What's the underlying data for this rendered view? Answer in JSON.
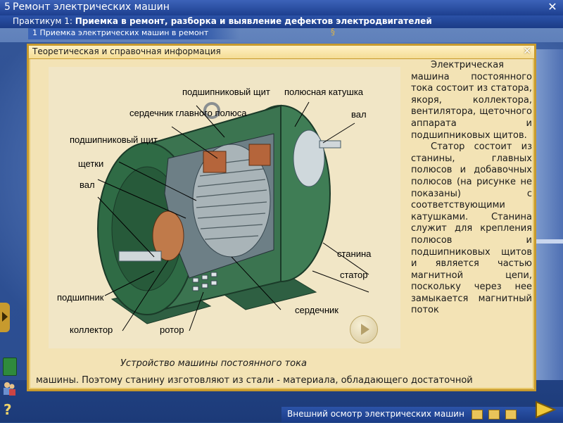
{
  "window": {
    "number": "5",
    "title": "Ремонт электрических машин"
  },
  "subtitle": {
    "prefix": "Практикум 1:",
    "text": "Приемка в ремонт, разборка и выявление дефектов электродвигателей"
  },
  "topic": "1 Приемка электрических машин в ремонт",
  "panel": {
    "title": "Теоретическая и справочная информация",
    "caption": "Устройство машины постоянного тока",
    "paragraph1": "Электрическая машина постоянного тока состоит из статора, якоря, коллектора, вентилятора, щеточного аппарата и подшипниковых щитов.",
    "paragraph2": "Статор состоит из станины, главных полюсов и добавочных полюсов (на рисунке не показаны) с соответствующими катушками. Станина служит для крепления полюсов и подшипниковых щитов и является частью магнитной цепи, поскольку через нее замыкается магнитный поток",
    "bottom_text": "машины. Поэтому станину изготовляют из стали - материала, обладающего достаточной"
  },
  "figure_labels": {
    "bearing_shield_top": "подшипниковый щит",
    "pole_coil": "полюсная катушка",
    "main_pole_core": "сердечник главного полюса",
    "shaft_right": "вал",
    "bearing_shield_left": "подшипниковый щит",
    "brushes": "щетки",
    "shaft_left": "вал",
    "frame": "станина",
    "stator": "статор",
    "bearing": "подшипник",
    "core": "сердечник",
    "collector": "коллектор",
    "rotor": "ротор"
  },
  "bottom_bar": {
    "label": "Внешний осмотр электрических машин"
  },
  "icons": {
    "close": "close-icon",
    "play": "play-icon",
    "next": "next-arrow-icon",
    "help": "help-icon",
    "book": "book-icon",
    "people": "people-icon"
  },
  "colors": {
    "titlebar": "#1d3f8f",
    "panel_bg": "#f3e3b5",
    "panel_border": "#c79a2e",
    "motor_green": "#2f6b45"
  }
}
